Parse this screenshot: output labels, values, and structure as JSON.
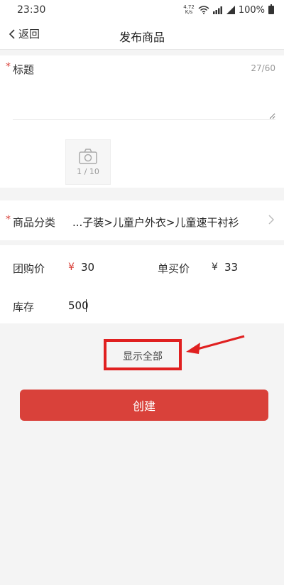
{
  "status_bar": {
    "time": "23:30",
    "net_speed_value": "4.72",
    "net_speed_unit": "K/s",
    "battery_percent": "100%"
  },
  "nav": {
    "back_label": "返回",
    "title": "发布商品"
  },
  "title_field": {
    "label": "标题",
    "counter": "27/60",
    "value": ""
  },
  "photo_upload": {
    "count": "1 / 10"
  },
  "category": {
    "label": "商品分类",
    "value": "...子装>儿童户外衣>儿童速干衬衫"
  },
  "pricing": {
    "group_price_label": "团购价",
    "group_price_symbol": "¥",
    "group_price_value": "30",
    "single_price_label": "单买价",
    "single_price_symbol": "¥",
    "single_price_value": "33"
  },
  "stock": {
    "label": "库存",
    "value": "500"
  },
  "actions": {
    "show_all_label": "显示全部",
    "create_label": "创建"
  },
  "colors": {
    "accent": "#d9413a",
    "highlight": "#e02020"
  }
}
